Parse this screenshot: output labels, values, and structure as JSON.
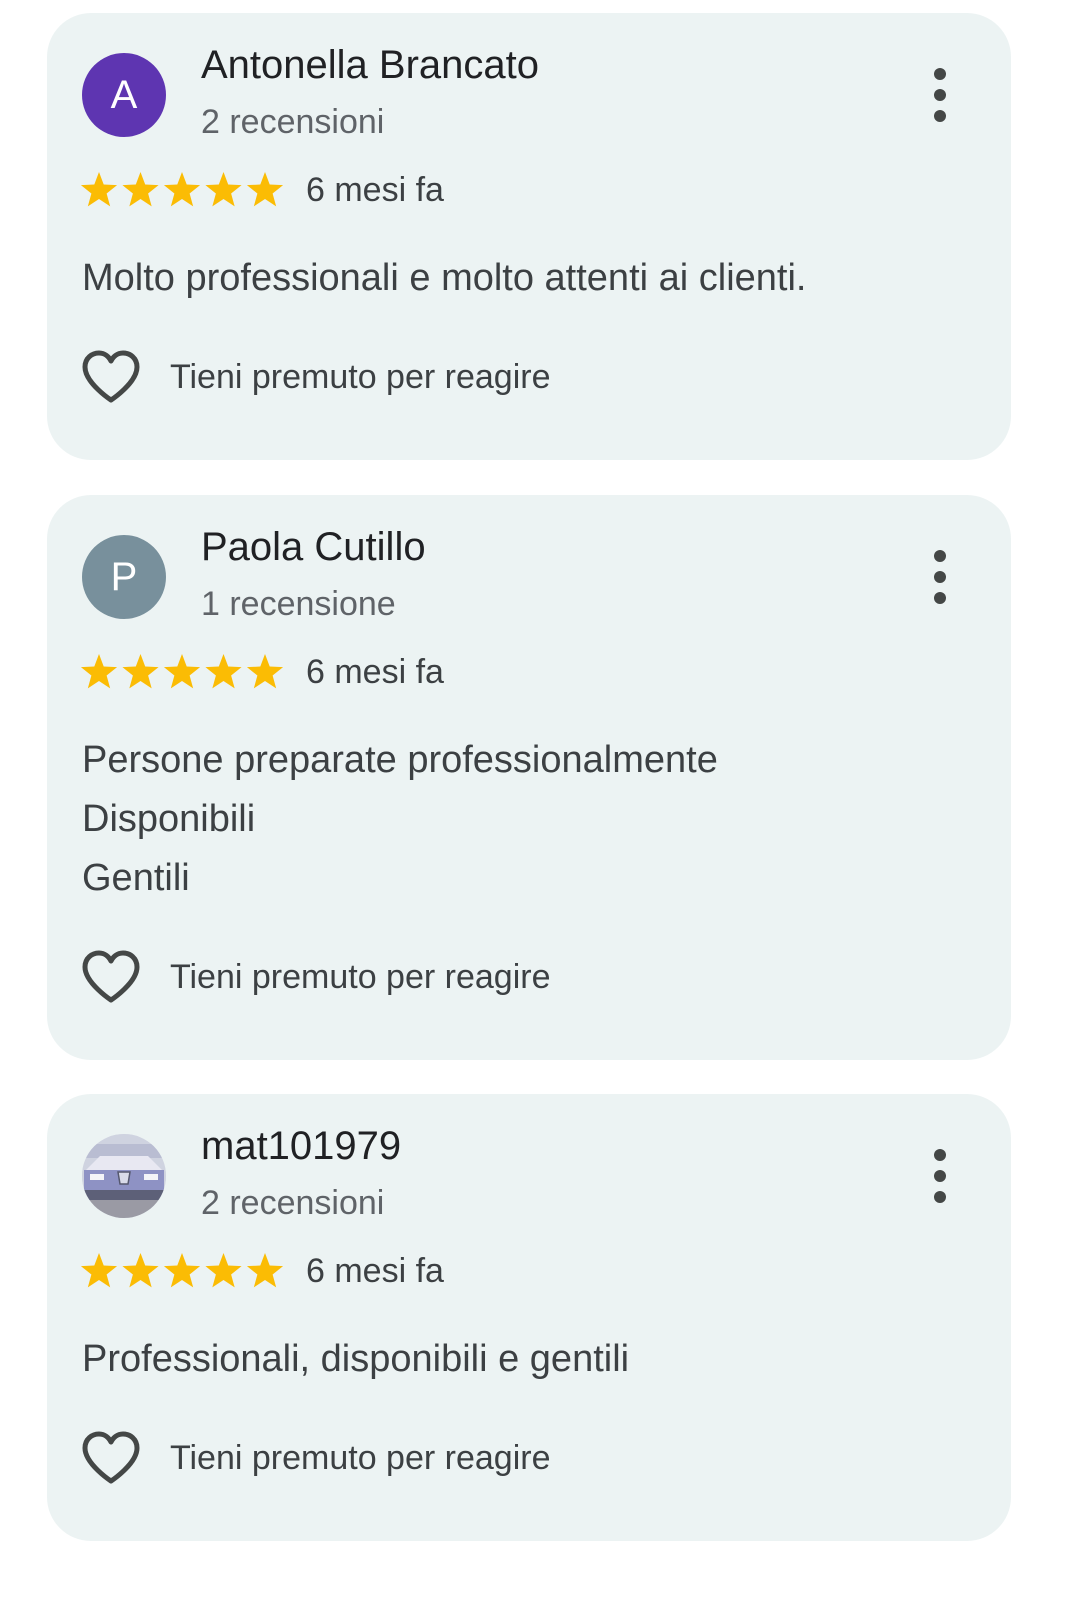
{
  "colors": {
    "card_background": "#ecf3f3",
    "star": "#fbbc04",
    "text_primary": "#202124",
    "text_secondary": "#5f6368"
  },
  "reviews": [
    {
      "avatar_letter": "A",
      "avatar_color": "#5e35b1",
      "name": "Antonella Brancato",
      "count": "2 recensioni",
      "rating": 5,
      "time": "6 mesi fa",
      "text": "Molto professionali e molto attenti ai clienti.",
      "react_label": "Tieni premuto per reagire",
      "more_icon": "more-vert-icon",
      "react_icon": "heart-outline-icon"
    },
    {
      "avatar_letter": "P",
      "avatar_color": "#78909c",
      "name": "Paola Cutillo",
      "count": "1 recensione",
      "rating": 5,
      "time": "6 mesi fa",
      "text": "Persone preparate professionalmente\nDisponibili\nGentili",
      "react_label": "Tieni premuto per reagire",
      "more_icon": "more-vert-icon",
      "react_icon": "heart-outline-icon"
    },
    {
      "avatar_letter": "",
      "avatar_image": "car-photo",
      "name": "mat101979",
      "count": "2 recensioni",
      "rating": 5,
      "time": "6 mesi fa",
      "text": "Professionali, disponibili e gentili",
      "react_label": "Tieni premuto per reagire",
      "more_icon": "more-vert-icon",
      "react_icon": "heart-outline-icon"
    }
  ]
}
